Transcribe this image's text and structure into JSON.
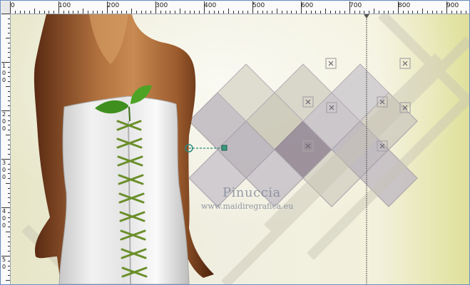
{
  "ruler": {
    "top_labels": [
      "0",
      "100",
      "200",
      "300",
      "400",
      "500",
      "600",
      "700",
      "800",
      "900"
    ],
    "left_labels": [
      "1",
      "0",
      "0",
      "2",
      "0",
      "0",
      "3",
      "0",
      "0",
      "4",
      "0",
      "0",
      "5",
      "0"
    ]
  },
  "watermark": {
    "line1": "Pinuccia",
    "line2": "www.maidiregrafica.eu"
  },
  "colors": {
    "ruler_bg": "#fafafa",
    "frame_border": "#6a8fc2",
    "guide_line": "#555555",
    "node_color": "#2a8a7a"
  },
  "canvas": {
    "subject": "woman-in-white-corset-dress-with-leaf",
    "background": "beige-yellow-geometric-diamonds"
  }
}
